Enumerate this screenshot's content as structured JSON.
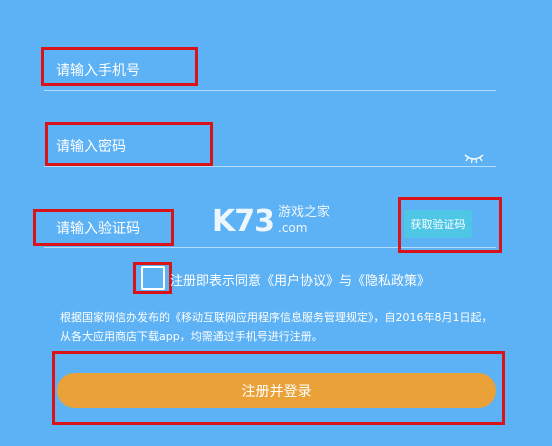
{
  "phone_field": {
    "placeholder": "请输入手机号"
  },
  "password_field": {
    "placeholder": "请输入密码",
    "toggle_icon": "eye-closed-icon"
  },
  "code_field": {
    "placeholder": "请输入验证码"
  },
  "get_code_button": {
    "label": "获取验证码"
  },
  "agreement": {
    "text": "注册即表示同意《用户协议》与《隐私政策》",
    "checked": false
  },
  "notice": {
    "text": "根据国家网信办发布的《移动互联网应用程序信息服务管理规定》，自2016年8月1日起，从各大应用商店下载app，均需通过手机号进行注册。"
  },
  "submit_button": {
    "label": "注册并登录"
  },
  "watermark": {
    "logo": "K73",
    "name": "游戏之家",
    "domain": ".com"
  },
  "colors": {
    "background": "#5db2f5",
    "code_button": "#4ec7e6",
    "submit_button": "#eaa238",
    "highlight": "#d8141a"
  }
}
